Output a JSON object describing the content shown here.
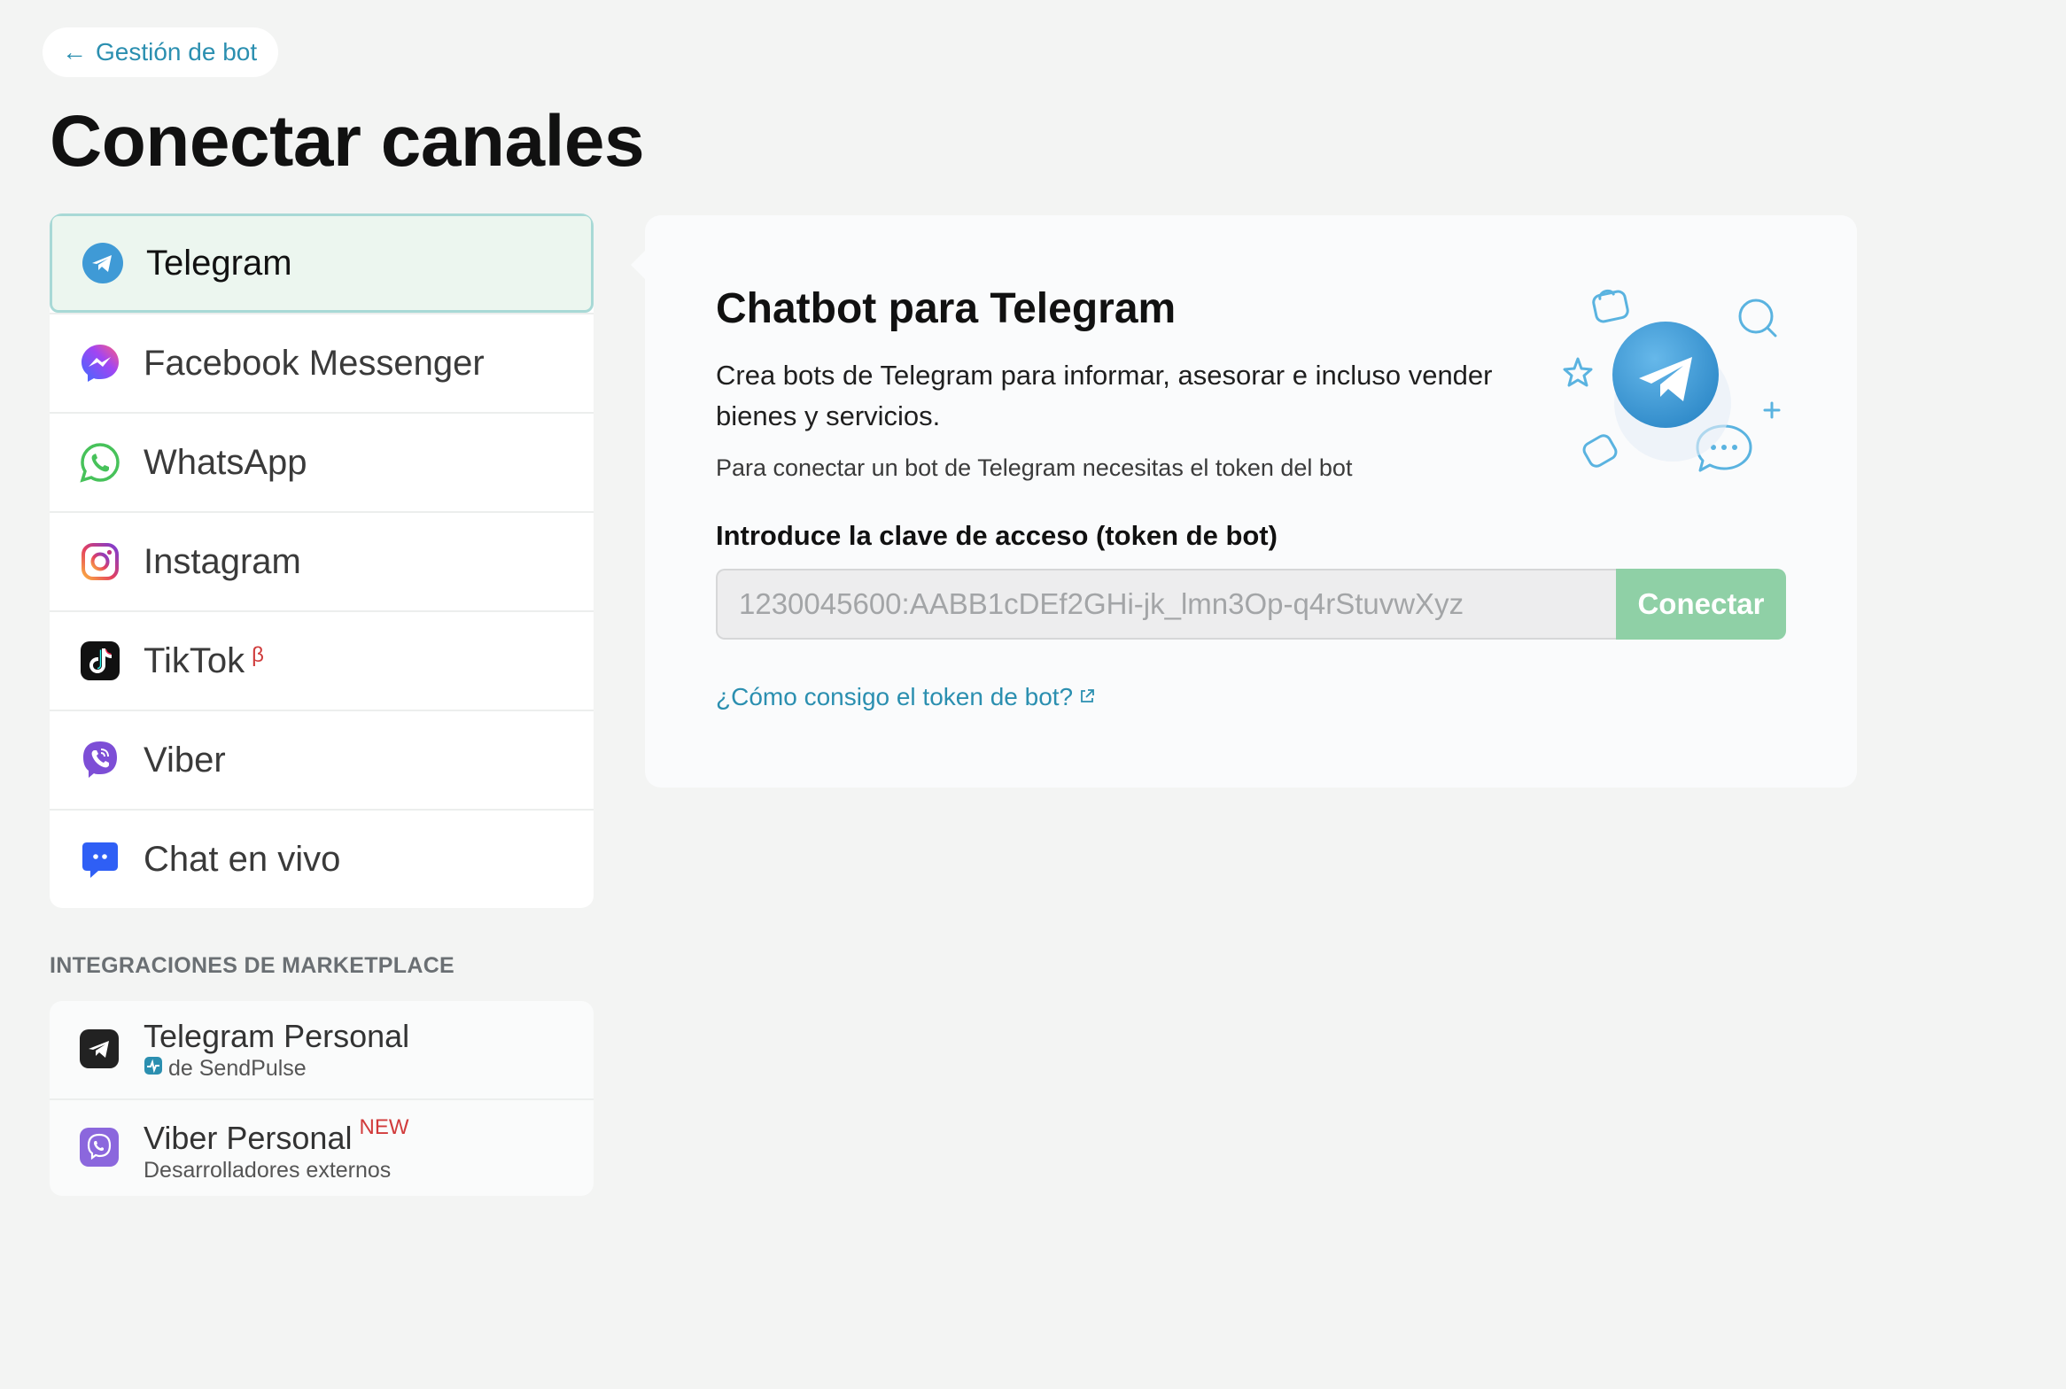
{
  "nav": {
    "back_label": "Gestión de bot"
  },
  "page": {
    "title": "Conectar canales"
  },
  "channels": [
    {
      "label": "Telegram",
      "icon": "telegram-icon",
      "active": true
    },
    {
      "label": "Facebook Messenger",
      "icon": "messenger-icon"
    },
    {
      "label": "WhatsApp",
      "icon": "whatsapp-icon"
    },
    {
      "label": "Instagram",
      "icon": "instagram-icon"
    },
    {
      "label": "TikTok",
      "icon": "tiktok-icon",
      "badge": "β"
    },
    {
      "label": "Viber",
      "icon": "viber-icon"
    },
    {
      "label": "Chat en vivo",
      "icon": "live-chat-icon"
    }
  ],
  "marketplace": {
    "section_label": "INTEGRACIONES DE MARKETPLACE",
    "items": [
      {
        "label": "Telegram Personal",
        "sub": "de SendPulse",
        "icon": "telegram-personal-icon"
      },
      {
        "label": "Viber Personal",
        "badge": "NEW",
        "sub": "Desarrolladores externos",
        "icon": "viber-personal-icon"
      }
    ]
  },
  "panel": {
    "title": "Chatbot para Telegram",
    "description": "Crea bots de Telegram para informar, asesorar e incluso vender bienes y servicios.",
    "note": "Para conectar un bot de Telegram necesitas el token del bot",
    "field_label": "Introduce la clave de acceso (token de bot)",
    "token_placeholder": "1230045600:AABB1cDEf2GHi-jk_lmn3Op-q4rStuvwXyz",
    "token_value": "",
    "connect_label": "Conectar",
    "help_link": "¿Cómo consigo el token de bot?"
  },
  "colors": {
    "accent": "#2b8fb0",
    "connect_button": "#8fd0a6",
    "active_item_bg": "#ecf6ef",
    "active_item_border": "#a8d9d6",
    "new_badge": "#d13b3b"
  }
}
